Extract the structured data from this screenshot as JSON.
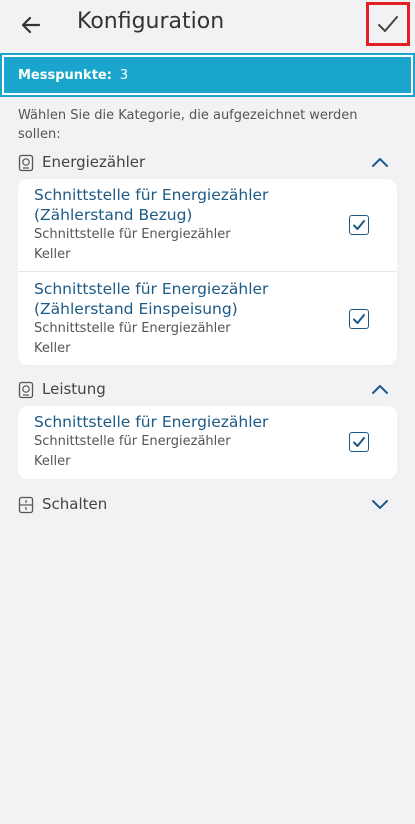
{
  "header": {
    "title": "Konfiguration",
    "back_icon": "arrow-left-icon",
    "confirm_icon": "checkmark-icon",
    "confirm_highlight_color": "#e31e24"
  },
  "messpunkte": {
    "label": "Messpunkte:",
    "value": "3",
    "bar_color": "#1aa6cc"
  },
  "intro_text": "Wählen Sie die Kategorie, die aufgezeichnet werden sollen:",
  "categories": [
    {
      "label": "Energiezähler",
      "icon": "meter-icon",
      "expanded": true,
      "items": [
        {
          "title_line1": "Schnittstelle für Energiezähler",
          "title_line2": "(Zählerstand Bezug)",
          "subtitle": "Schnittstelle für Energiezähler",
          "location": "Keller",
          "checked": true
        },
        {
          "title_line1": "Schnittstelle für Energiezähler",
          "title_line2": "(Zählerstand Einspeisung)",
          "subtitle": "Schnittstelle für Energiezähler",
          "location": "Keller",
          "checked": true
        }
      ]
    },
    {
      "label": "Leistung",
      "icon": "meter-icon",
      "expanded": true,
      "items": [
        {
          "title_line1": "Schnittstelle für Energiezähler",
          "subtitle": "Schnittstelle für Energiezähler",
          "location": "Keller",
          "checked": true
        }
      ]
    },
    {
      "label": "Schalten",
      "icon": "switch-box-icon",
      "expanded": false,
      "items": []
    }
  ],
  "colors": {
    "background": "#f2f2f5",
    "title_text": "#1d5a86",
    "checkbox": "#1b5a87"
  }
}
